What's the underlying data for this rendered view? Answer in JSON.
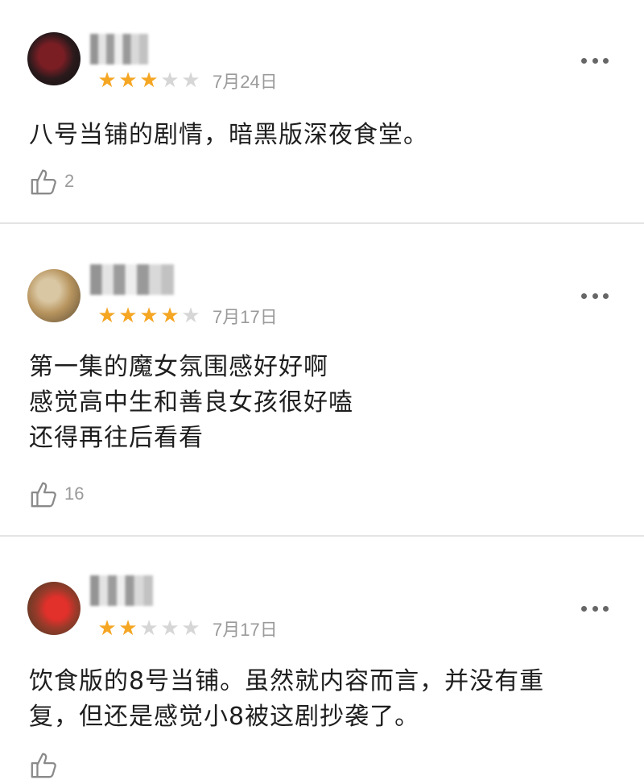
{
  "reviews": [
    {
      "stars_filled": 3,
      "stars_total": 5,
      "date": "7月24日",
      "text": "八号当铺的剧情，暗黑版深夜食堂。",
      "likes": "2"
    },
    {
      "stars_filled": 4,
      "stars_total": 5,
      "date": "7月17日",
      "text": "第一集的魔女氛围感好好啊\n感觉高中生和善良女孩很好嗑\n还得再往后看看",
      "likes": "16"
    },
    {
      "stars_filled": 2,
      "stars_total": 5,
      "date": "7月17日",
      "text": "饮食版的8号当铺。虽然就内容而言，并没有重\n复，但还是感觉小8被这剧抄袭了。",
      "likes": ""
    }
  ],
  "icons": {
    "star": "star-icon",
    "more": "more-options-icon",
    "like": "thumbs-up-icon"
  },
  "colors": {
    "star_filled": "#f5a623",
    "star_empty": "#d6d6d6",
    "meta_text": "#9a9a9a"
  }
}
